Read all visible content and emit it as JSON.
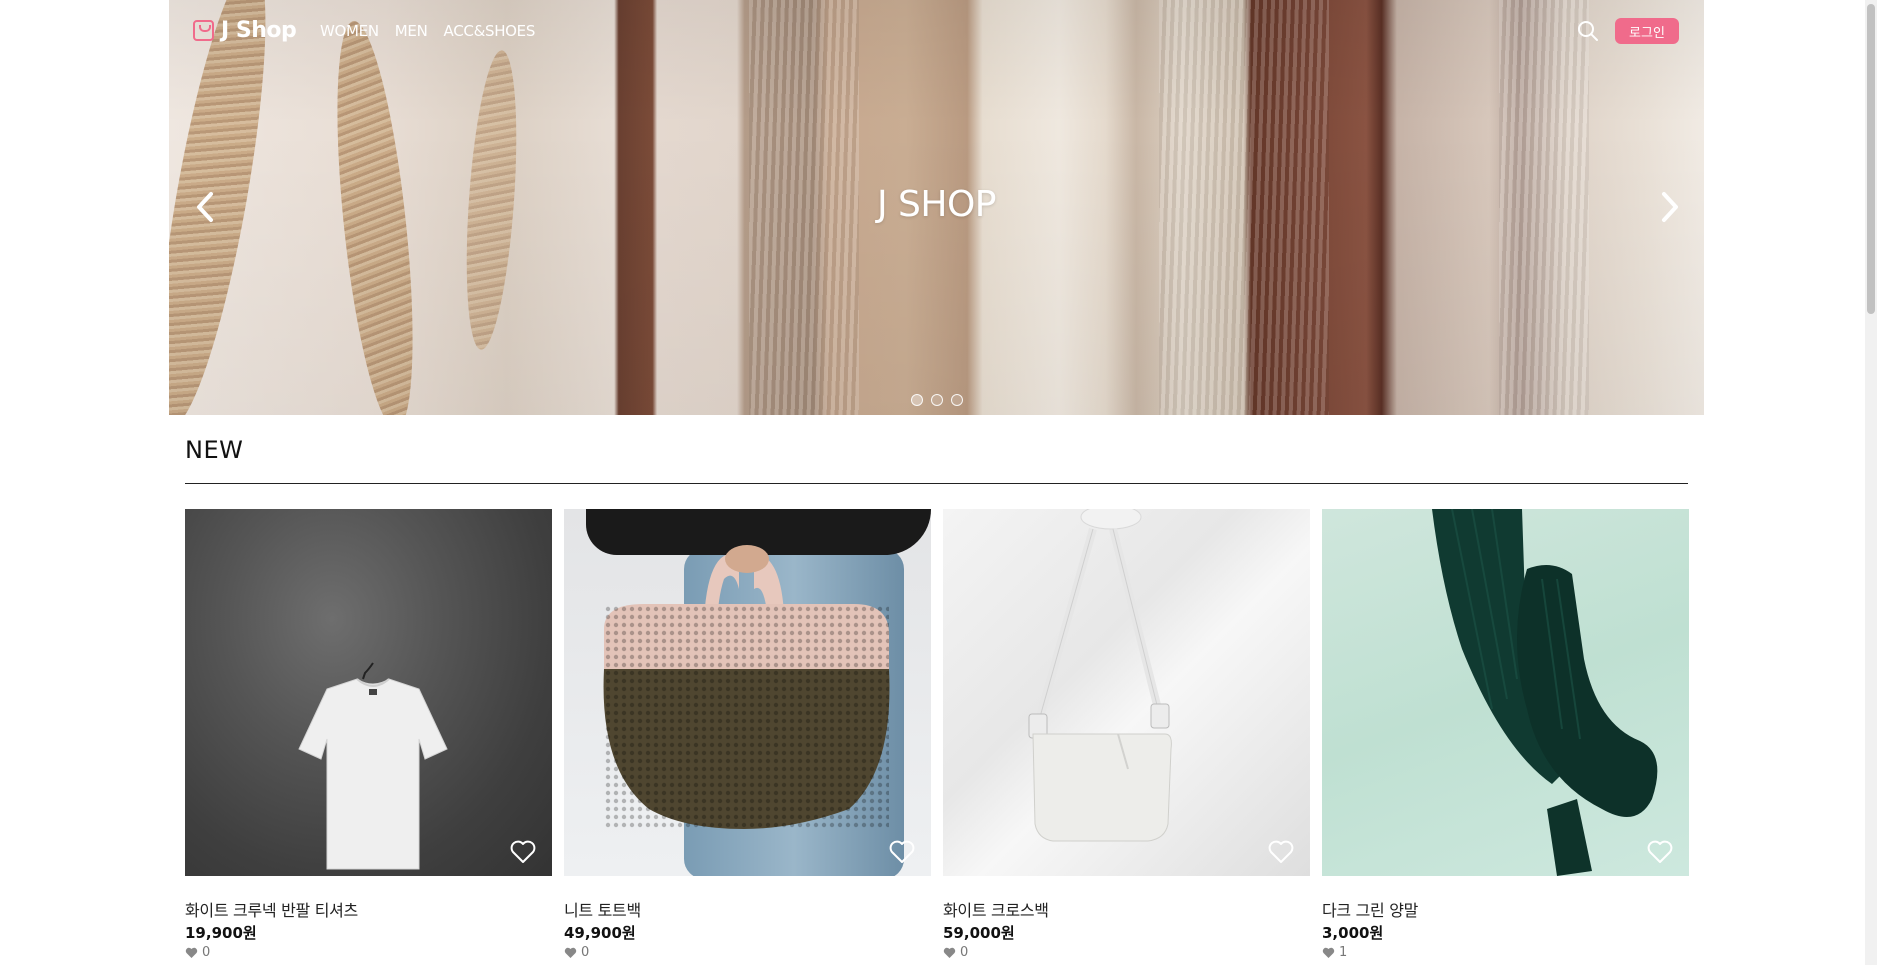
{
  "brand": {
    "name": "J Shop"
  },
  "nav": {
    "menu": [
      {
        "label": "WOMEN"
      },
      {
        "label": "MEN"
      },
      {
        "label": "ACC&SHOES"
      }
    ],
    "login_label": "로그인",
    "search_icon": "search-icon"
  },
  "hero": {
    "title": "J SHOP",
    "slides": 3,
    "active_slide": 1
  },
  "section": {
    "title": "NEW"
  },
  "products": [
    {
      "name": "화이트 크루넥 반팔 티셔츠",
      "price": "19,900원",
      "likes": "0"
    },
    {
      "name": "니트 토트백",
      "price": "49,900원",
      "likes": "0"
    },
    {
      "name": "화이트 크로스백",
      "price": "59,000원",
      "likes": "0"
    },
    {
      "name": "다크 그린 양말",
      "price": "3,000원",
      "likes": "1"
    }
  ],
  "colors": {
    "accent": "#f06b8b",
    "text": "#222222",
    "white": "#ffffff"
  }
}
